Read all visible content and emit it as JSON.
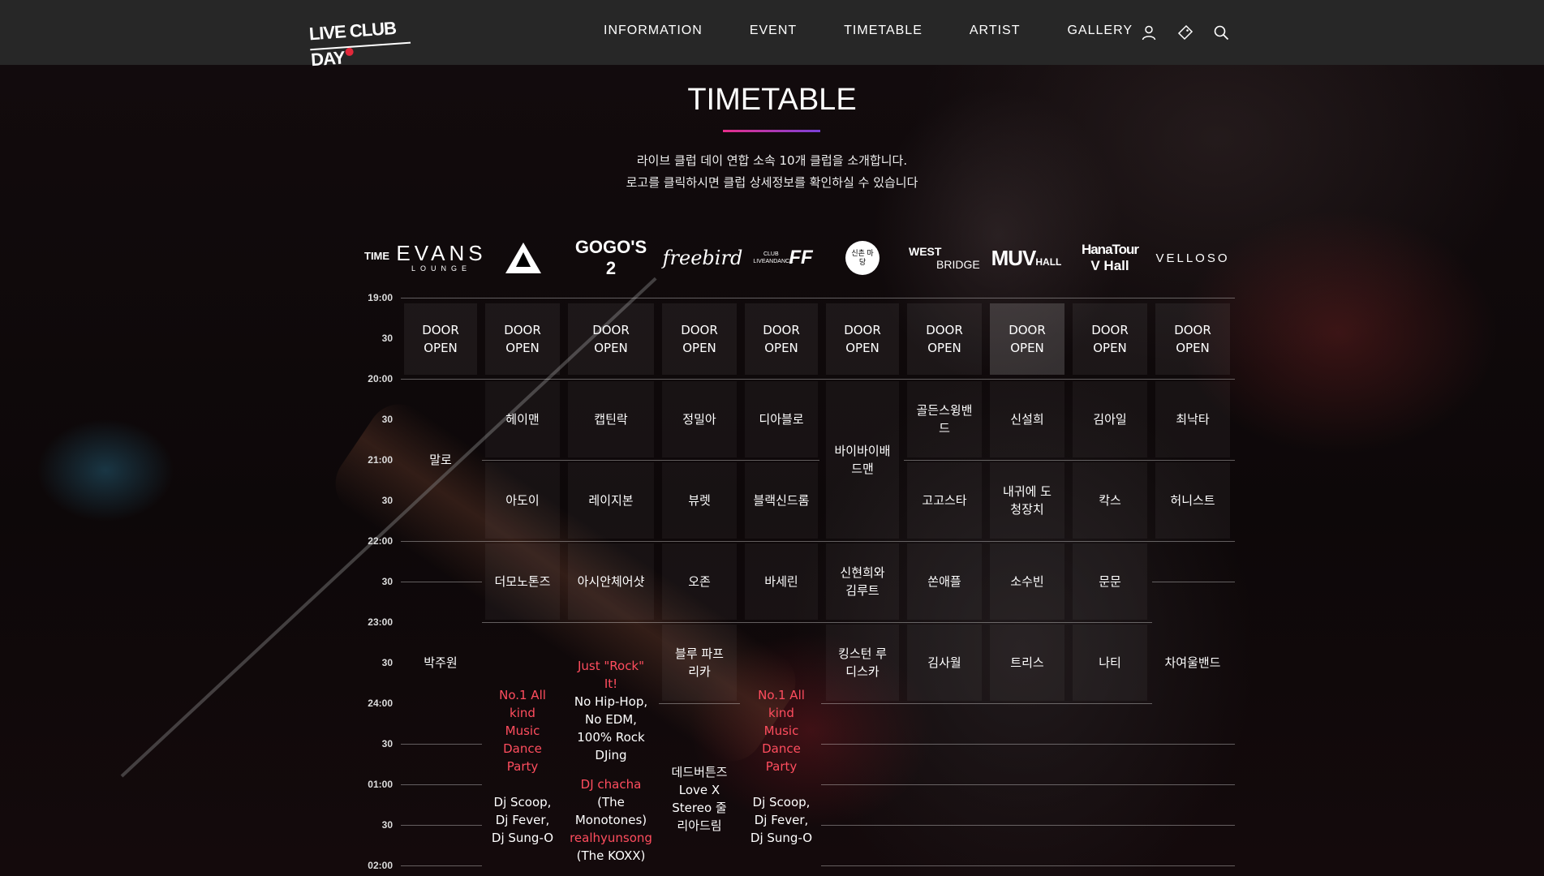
{
  "header": {
    "logo_text": "LIVE CLUB DAY",
    "nav": [
      "INFORMATION",
      "EVENT",
      "TIMETABLE",
      "ARTIST",
      "GALLERY"
    ],
    "icons": [
      "user-icon",
      "ticket-icon",
      "search-icon"
    ]
  },
  "page": {
    "title": "TIMETABLE",
    "intro_line1": "라이브 클럽 데이 연합 소속 10개 클럽을 소개합니다.",
    "intro_line2": "로고를 클릭하시면 클럽 상세정보를 확인하실 수 있습니다"
  },
  "timetable": {
    "time_header": "TIME",
    "clubs": [
      {
        "name": "EVANS",
        "sub": "LOUNGE"
      },
      {
        "name": "PRISM"
      },
      {
        "name": "GOGO'S 2"
      },
      {
        "name": "freebird"
      },
      {
        "name": "FF",
        "sub": "CLUB LIVEANDANCE"
      },
      {
        "name": "신촌 마당",
        "sub": "신촌마당"
      },
      {
        "name": "WEST",
        "sub": "BRIDGE"
      },
      {
        "name": "MUV",
        "sub": "HALL"
      },
      {
        "name": "HanaTour",
        "sub": "V Hall"
      },
      {
        "name": "VELLOSO"
      }
    ],
    "times": [
      "19:00",
      "30",
      "20:00",
      "30",
      "21:00",
      "30",
      "22:00",
      "30",
      "23:00",
      "30",
      "24:00",
      "30",
      "01:00",
      "30",
      "02:00"
    ],
    "door_open": "DOOR OPEN",
    "acts": {
      "c0_1": "말로",
      "c0_2": "박주원",
      "c1_1": "헤이맨",
      "c1_2": "아도이",
      "c1_3": "더모노톤즈",
      "c1_4a": "No.1 All kind Music Dance Party",
      "c1_4b": "Dj Scoop, Dj Fever, Dj Sung-O",
      "c2_1": "캡틴락",
      "c2_2": "레이지본",
      "c2_3": "아시안체어샷",
      "c2_4a": "Just \"Rock\" It!",
      "c2_4b": "No Hip-Hop, No EDM, 100% Rock DJing",
      "c2_4c": "DJ chacha",
      "c2_4d": "(The Monotones)",
      "c2_4e": "realhyunsong",
      "c2_4f": "(The KOXX)",
      "c3_1": "정밀아",
      "c3_2": "뷰렛",
      "c3_3": "오존",
      "c3_4": "블루 파프리카",
      "c3_5": "데드버튼즈 Love X Stereo 줄리아드림",
      "c4_1": "디아블로",
      "c4_2": "블랙신드롬",
      "c4_3": "바세린",
      "c4_4a": "No.1 All kind Music Dance Party",
      "c4_4b": "Dj Scoop, Dj Fever, Dj Sung-O",
      "c5_1": "바이바이배드맨",
      "c5_2": "신현희와 김루트",
      "c5_3": "킹스턴 루디스카",
      "c6_1": "골든스윙밴드",
      "c6_2": "고고스타",
      "c6_3": "쏜애플",
      "c6_4": "김사월",
      "c7_1": "신설희",
      "c7_2": "내귀에 도청장치",
      "c7_3": "소수빈",
      "c7_4": "트리스",
      "c8_1": "김아일",
      "c8_2": "칵스",
      "c8_3": "문문",
      "c8_4": "나티",
      "c9_1": "최낙타",
      "c9_2": "허니스트",
      "c9_3": "차여울밴드"
    }
  }
}
